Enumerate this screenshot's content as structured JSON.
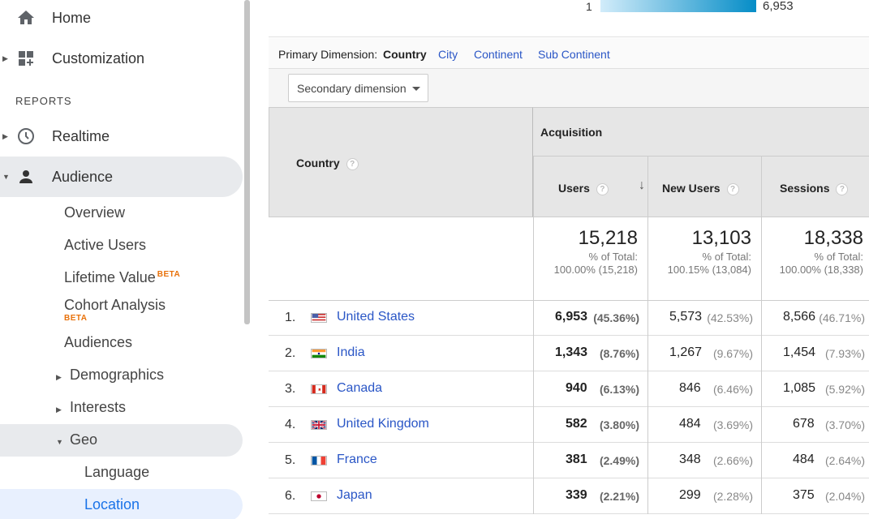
{
  "sidebar": {
    "home": "Home",
    "customization": "Customization",
    "reports_heading": "REPORTS",
    "realtime": "Realtime",
    "audience": "Audience",
    "sub": {
      "overview": "Overview",
      "active_users": "Active Users",
      "lifetime_value": "Lifetime Value",
      "lifetime_badge": "BETA",
      "cohort": "Cohort Analysis",
      "cohort_badge": "BETA",
      "audiences": "Audiences",
      "demographics": "Demographics",
      "interests": "Interests",
      "geo": "Geo",
      "language": "Language",
      "location": "Location"
    }
  },
  "map_scale": {
    "min": "1",
    "max": "6,953"
  },
  "dimensions": {
    "label": "Primary Dimension:",
    "active": "Country",
    "options": [
      "City",
      "Continent",
      "Sub Continent"
    ]
  },
  "secondary_dimension": "Secondary dimension",
  "table": {
    "country_header": "Country",
    "group_header": "Acquisition",
    "columns": [
      "Users",
      "New Users",
      "Sessions"
    ],
    "help_glyph": "?",
    "sort_glyph": "↓",
    "totals": [
      {
        "value": "15,218",
        "label": "% of Total:",
        "pct": "100.00% (15,218)"
      },
      {
        "value": "13,103",
        "label": "% of Total:",
        "pct": "100.15% (13,084)"
      },
      {
        "value": "18,338",
        "label": "% of Total:",
        "pct": "100.00% (18,338)"
      }
    ],
    "rows": [
      {
        "rank": "1.",
        "country": "United States",
        "flag": "us-flag-icon",
        "users": "6,953",
        "users_pct": "(45.36%)",
        "new_users": "5,573",
        "new_users_pct": "(42.53%)",
        "sessions": "8,566",
        "sessions_pct": "(46.71%)"
      },
      {
        "rank": "2.",
        "country": "India",
        "flag": "india-flag-icon",
        "users": "1,343",
        "users_pct": "(8.76%)",
        "new_users": "1,267",
        "new_users_pct": "(9.67%)",
        "sessions": "1,454",
        "sessions_pct": "(7.93%)"
      },
      {
        "rank": "3.",
        "country": "Canada",
        "flag": "canada-flag-icon",
        "users": "940",
        "users_pct": "(6.13%)",
        "new_users": "846",
        "new_users_pct": "(6.46%)",
        "sessions": "1,085",
        "sessions_pct": "(5.92%)"
      },
      {
        "rank": "4.",
        "country": "United Kingdom",
        "flag": "uk-flag-icon",
        "users": "582",
        "users_pct": "(3.80%)",
        "new_users": "484",
        "new_users_pct": "(3.69%)",
        "sessions": "678",
        "sessions_pct": "(3.70%)"
      },
      {
        "rank": "5.",
        "country": "France",
        "flag": "france-flag-icon",
        "users": "381",
        "users_pct": "(2.49%)",
        "new_users": "348",
        "new_users_pct": "(2.66%)",
        "sessions": "484",
        "sessions_pct": "(2.64%)"
      },
      {
        "rank": "6.",
        "country": "Japan",
        "flag": "japan-flag-icon",
        "users": "339",
        "users_pct": "(2.21%)",
        "new_users": "299",
        "new_users_pct": "(2.28%)",
        "sessions": "375",
        "sessions_pct": "(2.04%)"
      }
    ]
  },
  "colors": {
    "link": "#2a56c6",
    "accent": "#1a73e8",
    "beta": "#e8710a",
    "scale_low": "#d2ecfa",
    "scale_high": "#058dc7"
  }
}
